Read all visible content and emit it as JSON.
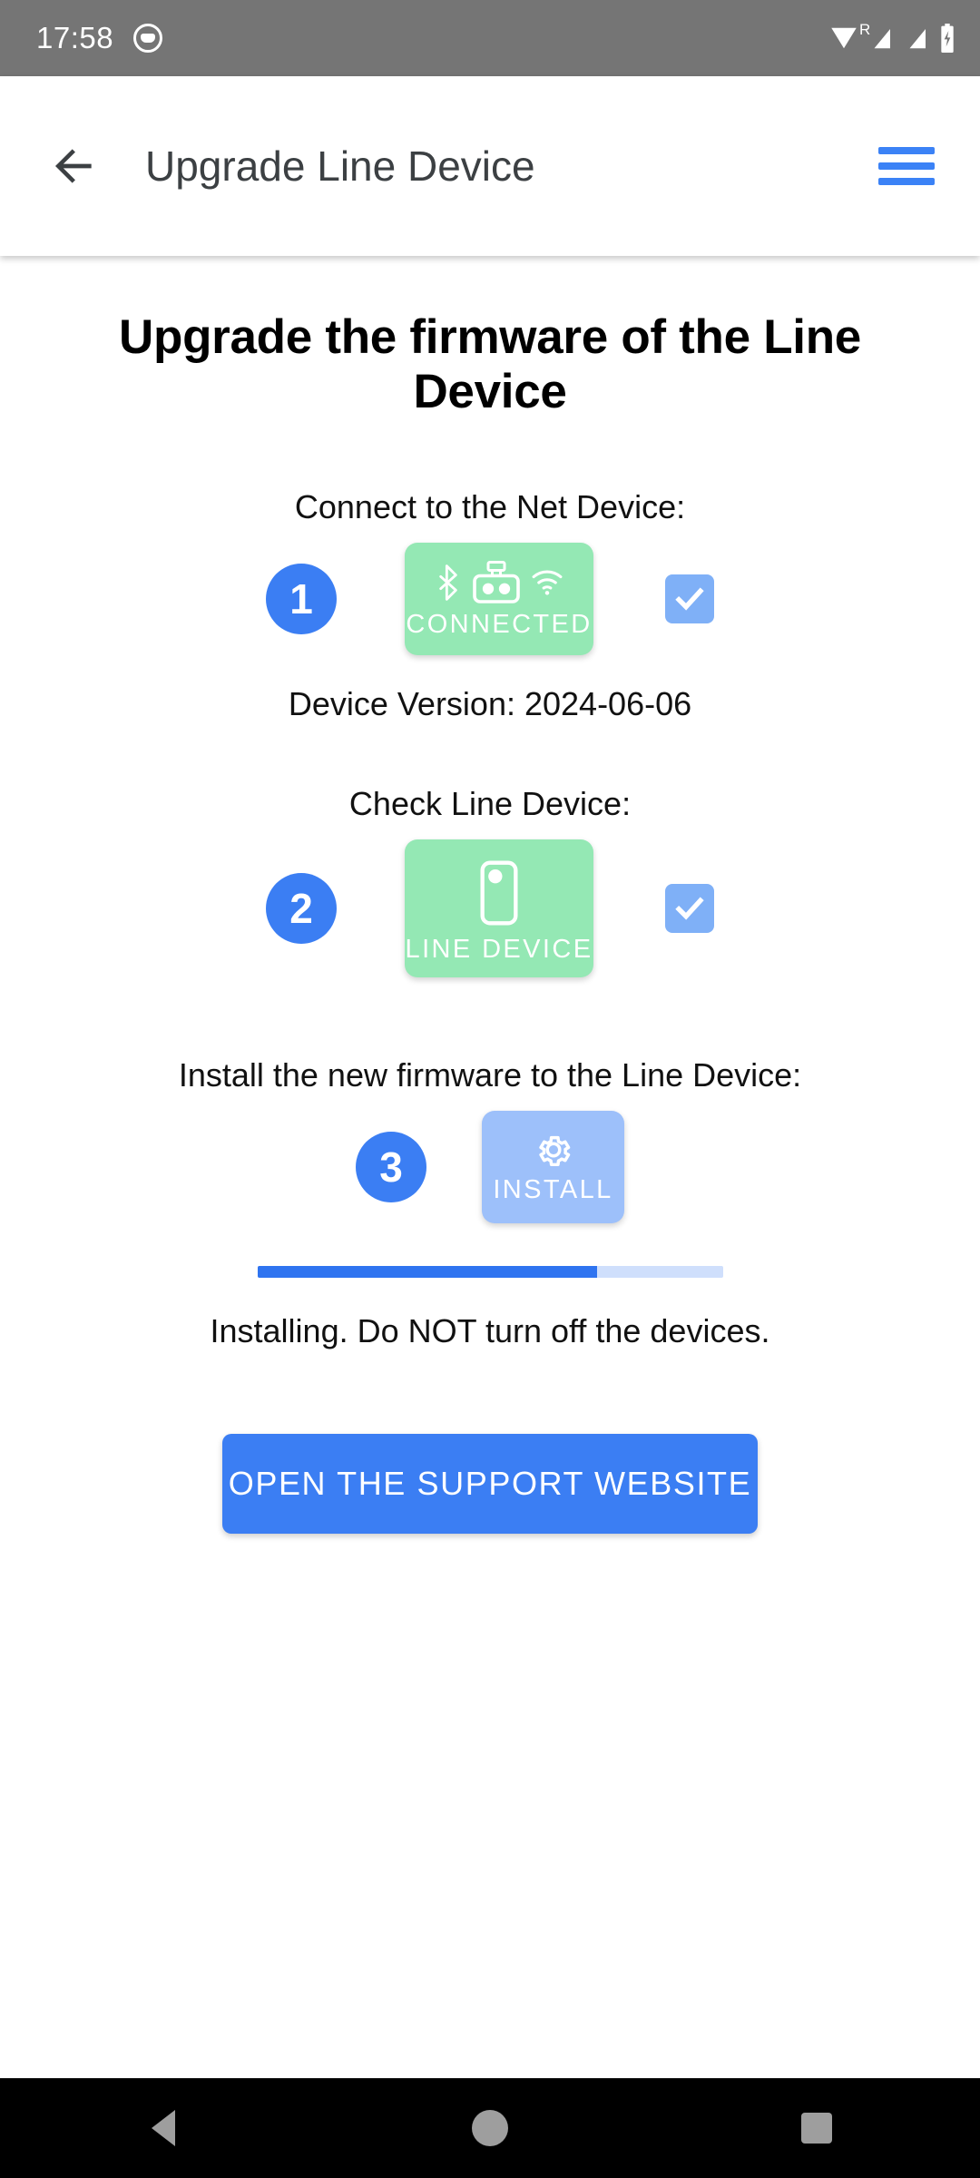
{
  "status_bar": {
    "time": "17:58",
    "icons": [
      "app-notification-icon",
      "wifi-icon",
      "roaming-signal-icon",
      "signal-icon",
      "battery-charging-icon"
    ],
    "roaming_label": "R",
    "background": "#757575"
  },
  "app_bar": {
    "back_icon": "arrow-back-icon",
    "title": "Upgrade Line Device",
    "menu_icon": "hamburger-menu-icon",
    "menu_color": "#3b82f6"
  },
  "page": {
    "title": "Upgrade the firmware of the Line Device"
  },
  "steps": [
    {
      "number": "1",
      "label": "Connect to the Net Device:",
      "card_text": "CONNECTED",
      "card_color": "#94e8b4",
      "card_icons": [
        "bluetooth-icon",
        "net-device-icon",
        "wifi-icon"
      ],
      "checked": true,
      "check_color": "#7fb0f7",
      "sub_text": "Device Version: 2024-06-06"
    },
    {
      "number": "2",
      "label": "Check Line Device:",
      "card_text": "LINE DEVICE",
      "card_color": "#94e8b4",
      "card_icons": [
        "line-device-icon"
      ],
      "checked": true,
      "check_color": "#7fb0f7"
    },
    {
      "number": "3",
      "label": "Install the new firmware to the Line Device:",
      "card_text": "INSTALL",
      "card_color": "#9dc0fa",
      "card_icons": [
        "gear-icon"
      ],
      "checked": false
    }
  ],
  "progress": {
    "percent": 73,
    "fill_color": "#2f74f0",
    "track_color": "#cfdffc",
    "status_text": "Installing. Do NOT turn off the devices."
  },
  "support": {
    "button_label": "OPEN THE SUPPORT WEBSITE",
    "button_color": "#3b7ef3"
  },
  "nav_bar": {
    "back_icon": "nav-back-icon",
    "home_icon": "nav-home-icon",
    "recents_icon": "nav-recents-icon"
  }
}
